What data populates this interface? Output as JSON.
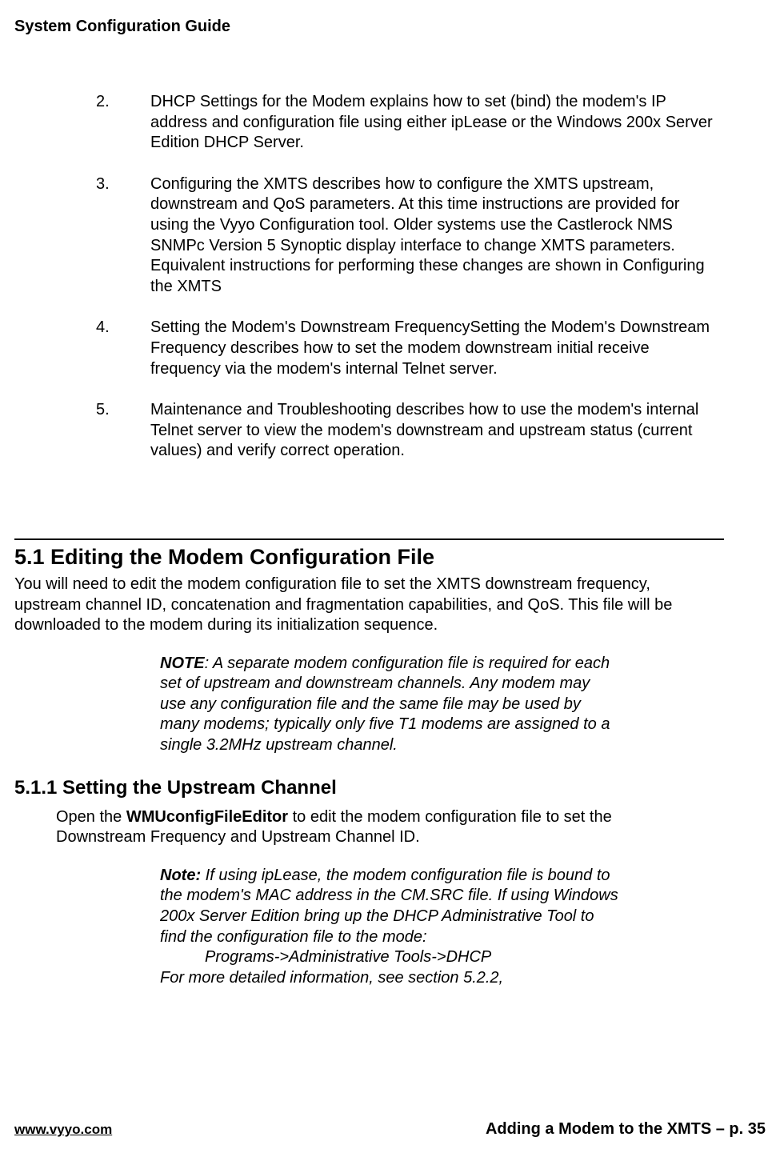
{
  "header": {
    "title": "System Configuration Guide"
  },
  "list": {
    "items": [
      {
        "num": "2.",
        "text": "DHCP Settings for the Modem explains how to set (bind) the modem's IP address and configuration file using either ipLease or the Windows 200x Server Edition DHCP Server."
      },
      {
        "num": "3.",
        "text": "Configuring the XMTS describes how to configure the XMTS upstream, downstream and QoS parameters. At this time instructions are provided for using the Vyyo Configuration tool.  Older systems use the Castlerock NMS SNMPc Version 5 Synoptic display interface to change XMTS parameters.  Equivalent instructions for performing these changes are shown in Configuring the XMTS"
      },
      {
        "num": "4.",
        "text": "Setting the Modem's Downstream FrequencySetting the Modem's Downstream Frequency describes how to set the modem downstream initial receive frequency via the modem's internal Telnet server."
      },
      {
        "num": "5.",
        "text": "Maintenance and Troubleshooting describes how to use the modem's internal Telnet server to view the modem's downstream and upstream status (current values) and verify correct operation."
      }
    ]
  },
  "section": {
    "heading": "5.1  Editing the Modem Configuration File",
    "para": "You will need to edit the modem configuration file to set the XMTS downstream frequency, upstream channel ID, concatenation and fragmentation capabilities, and QoS.  This file will be downloaded to the modem during its initialization sequence.",
    "note_label": "NOTE",
    "note_text": ": A separate modem configuration file is required for each set of upstream and downstream channels.  Any modem may use any configuration file and the same file may be used by many modems; typically only five T1 modems are assigned to a single 3.2MHz upstream channel."
  },
  "subsection": {
    "heading": "5.1.1  Setting the Upstream Channel",
    "para_pre": "Open the ",
    "para_bold": "WMUconfigFileEditor",
    "para_post": " to edit the modem configuration file to set the Downstream Frequency and Upstream Channel ID.",
    "note_label": "Note:",
    "note_line1": " If using ipLease, the modem configuration file is bound to the modem's MAC address in the CM.SRC file.  If using Windows 200x Server Edition bring up the DHCP Administrative Tool to find the configuration file to the mode:",
    "note_indent": "Programs->Administrative Tools->DHCP",
    "note_line2": "For more detailed information, see section 5.2.2,"
  },
  "footer": {
    "url": "www.vyyo.com",
    "page": "Adding a Modem to the XMTS – p. 35"
  }
}
